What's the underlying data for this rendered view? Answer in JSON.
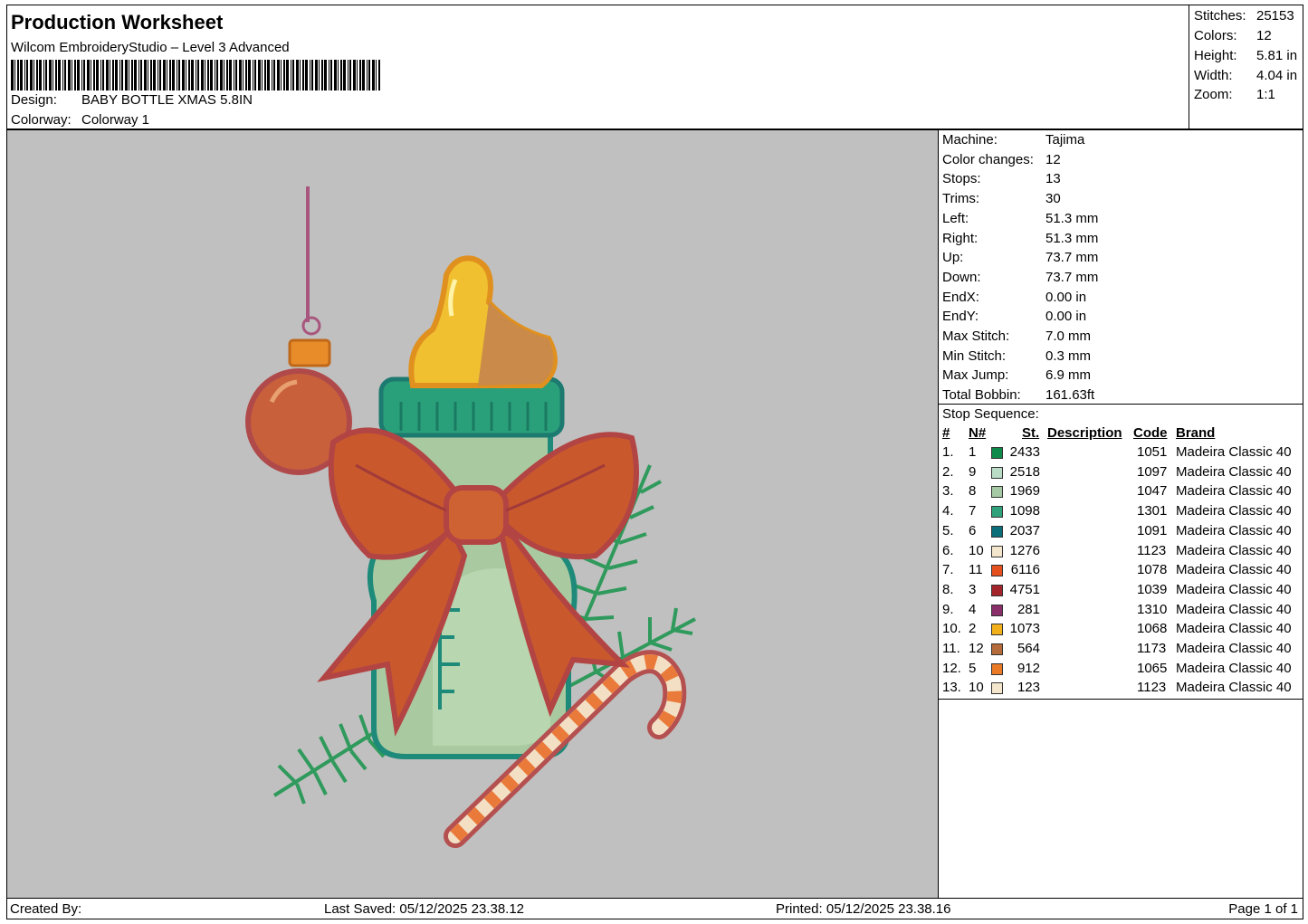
{
  "header": {
    "title": "Production Worksheet",
    "software": "Wilcom EmbroideryStudio – Level 3 Advanced",
    "design_label": "Design:",
    "design_value": "BABY BOTTLE XMAS 5.8IN",
    "colorway_label": "Colorway:",
    "colorway_value": "Colorway 1"
  },
  "stats": {
    "stitches_label": "Stitches:",
    "stitches": "25153",
    "colors_label": "Colors:",
    "colors": "12",
    "height_label": "Height:",
    "height": "5.81 in",
    "width_label": "Width:",
    "width": "4.04 in",
    "zoom_label": "Zoom:",
    "zoom": "1:1"
  },
  "machine": [
    {
      "label": "Machine:",
      "value": "Tajima"
    },
    {
      "label": "Color changes:",
      "value": "12"
    },
    {
      "label": "Stops:",
      "value": "13"
    },
    {
      "label": "Trims:",
      "value": "30"
    },
    {
      "label": "Left:",
      "value": "51.3 mm"
    },
    {
      "label": "Right:",
      "value": "51.3 mm"
    },
    {
      "label": "Up:",
      "value": "73.7 mm"
    },
    {
      "label": "Down:",
      "value": "73.7 mm"
    },
    {
      "label": "EndX:",
      "value": "0.00 in"
    },
    {
      "label": "EndY:",
      "value": "0.00 in"
    },
    {
      "label": "Max Stitch:",
      "value": "7.0 mm"
    },
    {
      "label": "Min Stitch:",
      "value": "0.3 mm"
    },
    {
      "label": "Max Jump:",
      "value": "6.9 mm"
    },
    {
      "label": "Total Bobbin:",
      "value": "161.63ft"
    }
  ],
  "sequence": {
    "title": "Stop Sequence:",
    "headers": {
      "num": "#",
      "n": "N#",
      "st": "St.",
      "desc": "Description",
      "code": "Code",
      "brand": "Brand"
    },
    "rows": [
      {
        "num": "1.",
        "n": "1",
        "color": "#0e8a4a",
        "st": "2433",
        "code": "1051",
        "brand": "Madeira Classic 40"
      },
      {
        "num": "2.",
        "n": "9",
        "color": "#b9dcc6",
        "st": "2518",
        "code": "1097",
        "brand": "Madeira Classic 40"
      },
      {
        "num": "3.",
        "n": "8",
        "color": "#a6c9a5",
        "st": "1969",
        "code": "1047",
        "brand": "Madeira Classic 40"
      },
      {
        "num": "4.",
        "n": "7",
        "color": "#2fa27c",
        "st": "1098",
        "code": "1301",
        "brand": "Madeira Classic 40"
      },
      {
        "num": "5.",
        "n": "6",
        "color": "#0b6e78",
        "st": "2037",
        "code": "1091",
        "brand": "Madeira Classic 40"
      },
      {
        "num": "6.",
        "n": "10",
        "color": "#f3e6cc",
        "st": "1276",
        "code": "1123",
        "brand": "Madeira Classic 40"
      },
      {
        "num": "7.",
        "n": "11",
        "color": "#e5501f",
        "st": "6116",
        "code": "1078",
        "brand": "Madeira Classic 40"
      },
      {
        "num": "8.",
        "n": "3",
        "color": "#a3242a",
        "st": "4751",
        "code": "1039",
        "brand": "Madeira Classic 40"
      },
      {
        "num": "9.",
        "n": "4",
        "color": "#8a2f6a",
        "st": "281",
        "code": "1310",
        "brand": "Madeira Classic 40"
      },
      {
        "num": "10.",
        "n": "2",
        "color": "#f2b01b",
        "st": "1073",
        "code": "1068",
        "brand": "Madeira Classic 40"
      },
      {
        "num": "11.",
        "n": "12",
        "color": "#b66b3a",
        "st": "564",
        "code": "1173",
        "brand": "Madeira Classic 40"
      },
      {
        "num": "12.",
        "n": "5",
        "color": "#ea7a26",
        "st": "912",
        "code": "1065",
        "brand": "Madeira Classic 40"
      },
      {
        "num": "13.",
        "n": "10",
        "color": "#f3e6cc",
        "st": "123",
        "code": "1123",
        "brand": "Madeira Classic 40"
      }
    ]
  },
  "footer": {
    "created_by": "Created By:",
    "last_saved": "Last Saved: 05/12/2025 23.38.12",
    "printed": "Printed: 05/12/2025 23.38.16",
    "page": "Page 1 of 1"
  }
}
